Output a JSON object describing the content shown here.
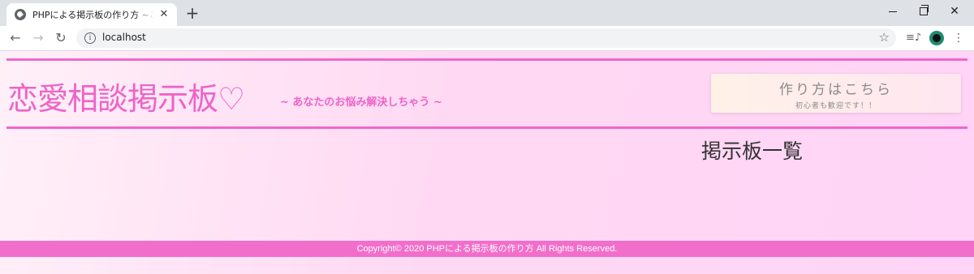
{
  "browser": {
    "tab": {
      "title": "PHPによる掲示板の作り方 ~ここはアンタを",
      "close_glyph": "✕",
      "favicon": "globe-icon"
    },
    "new_tab_glyph": "+",
    "window_controls": {
      "close_glyph": "✕"
    },
    "nav": {
      "back_glyph": "←",
      "forward_glyph": "→",
      "reload_glyph": "↻"
    },
    "address_bar": {
      "url": "localhost",
      "info_glyph": "i",
      "star_glyph": "☆"
    },
    "extensions": {
      "media_glyph": "≡♪",
      "menu_glyph": "⋮"
    }
  },
  "site": {
    "title": "恋愛相談掲示板♡",
    "subtitle": "~ あなたのお悩み解決しちゃう ~",
    "howto": {
      "main": "作り方はこちら",
      "sub": "初心者も歓迎です！！"
    },
    "board_heading": "掲示板一覧",
    "footer": "Copyright© 2020 PHPによる掲示板の作り方 All Rights Reserved."
  },
  "colors": {
    "accent_pink": "#ee64c7",
    "footer_pink": "#f26ecb",
    "page_background": "#ffd9f3"
  }
}
